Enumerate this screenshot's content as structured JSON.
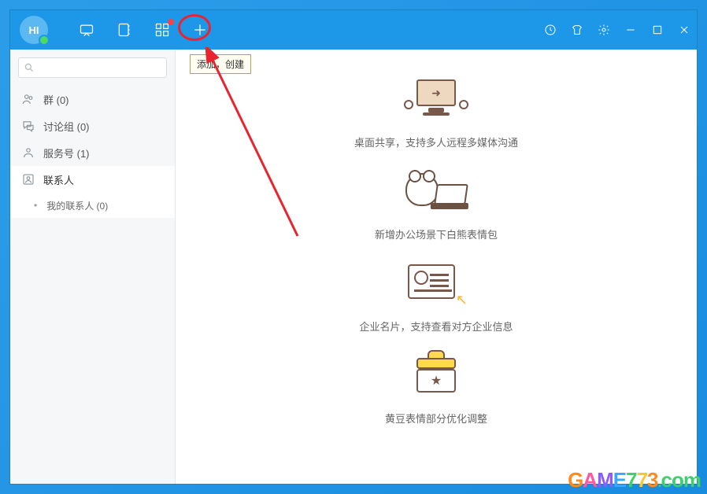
{
  "logo_text": "HI",
  "tooltip": "添加，创建",
  "search": {
    "placeholder": ""
  },
  "sidebar": {
    "items": [
      {
        "label": "群 (0)"
      },
      {
        "label": "讨论组 (0)"
      },
      {
        "label": "服务号 (1)"
      },
      {
        "label": "联系人"
      }
    ],
    "sub": {
      "label": "我的联系人 (0)"
    }
  },
  "features": [
    {
      "text": "桌面共享，支持多人远程多媒体沟通"
    },
    {
      "text": "新增办公场景下白熊表情包"
    },
    {
      "text": "企业名片，支持查看对方企业信息"
    },
    {
      "text": "黄豆表情部分优化调整"
    }
  ],
  "watermark": "GAME773.com"
}
